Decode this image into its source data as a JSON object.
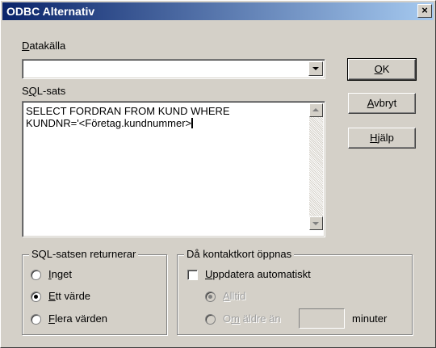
{
  "window": {
    "title": "ODBC Alternativ",
    "close": "×"
  },
  "datasource": {
    "label_accel": "D",
    "label_rest": "atakälla",
    "value": ""
  },
  "sql": {
    "label_pre": "S",
    "label_accel": "Q",
    "label_rest": "L-sats",
    "value": "SELECT FORDRAN FROM KUND WHERE\nKUNDNR='<Företag.kundnummer>"
  },
  "buttons": {
    "ok": {
      "accel": "O",
      "rest": "K"
    },
    "cancel": {
      "accel": "A",
      "rest": "vbryt"
    },
    "help": {
      "accel": "H",
      "rest": "jälp"
    }
  },
  "returns_group": {
    "title": "SQL-satsen returnerar",
    "options": [
      {
        "accel": "I",
        "rest": "nget",
        "selected": false
      },
      {
        "accel": "E",
        "rest": "tt värde",
        "selected": true
      },
      {
        "accel": "F",
        "rest": "lera värden",
        "selected": false
      }
    ]
  },
  "contact_group": {
    "title": "Då kontaktkort öppnas",
    "auto_update": {
      "accel": "U",
      "rest": "ppdatera automatiskt",
      "checked": false
    },
    "always": {
      "accel": "A",
      "rest": "lltid",
      "selected": true,
      "enabled": false
    },
    "older": {
      "pre": "O",
      "accel": "m",
      "rest": " äldre än",
      "selected": false,
      "enabled": false
    },
    "minutes_value": "",
    "minutes_label": "minuter"
  }
}
